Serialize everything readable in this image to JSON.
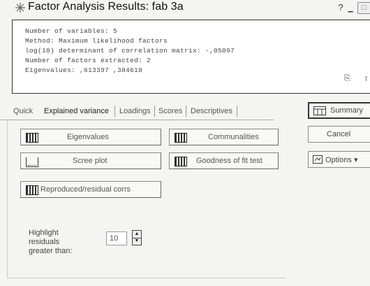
{
  "window": {
    "title": "Factor Analysis Results: fab 3a",
    "help_label": "?",
    "minimize_label": "_",
    "maximize_label": "□"
  },
  "results": {
    "lines": [
      "Number of variables: 5",
      "Method: Maximum likelihood factors",
      "log(10) determinant of correlation matrix: -,05097",
      "Number of factors extracted: 2",
      "Eigenvalues: ,613397 ,384618"
    ]
  },
  "tabs": [
    {
      "label": "Quick",
      "active": false
    },
    {
      "label": "Explained variance",
      "active": true
    },
    {
      "label": "Loadings",
      "active": false
    },
    {
      "label": "Scores",
      "active": false
    },
    {
      "label": "Descriptives",
      "active": false
    }
  ],
  "panel": {
    "eigenvalues_label": "Eigenvalues",
    "communalities_label": "Communalities",
    "scree_plot_label": "Scree plot",
    "goodness_label": "Goodness of fit test",
    "reproduced_label": "Reproduced/residual corrs",
    "highlight_label": "Highlight residuals greater than:",
    "highlight_value": "10"
  },
  "side": {
    "summary_label": "Summary",
    "cancel_label": "Cancel",
    "options_label": "Options ▾"
  }
}
